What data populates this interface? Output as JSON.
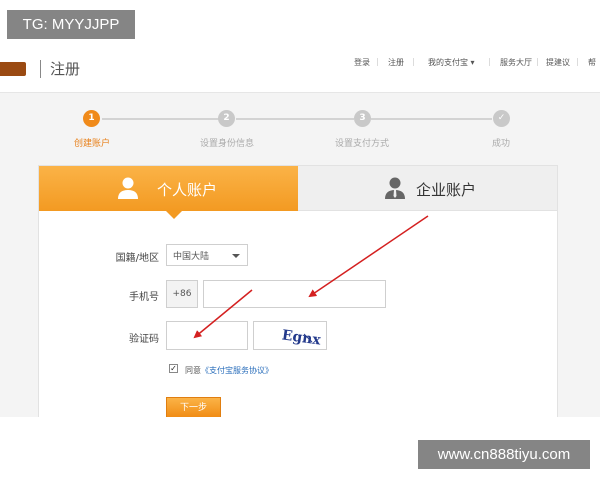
{
  "overlay": {
    "tg_label": "TG: MYYJJPP",
    "watermark": "www.cn888tiyu.com"
  },
  "header": {
    "page_title": "注册",
    "nav": [
      "登录",
      "注册",
      "我的支付宝 ▾",
      "服务大厅",
      "提建议",
      "帮"
    ]
  },
  "stepper": {
    "steps": [
      {
        "number": "1",
        "label": "创建账户",
        "active": true
      },
      {
        "number": "2",
        "label": "设置身份信息",
        "active": false
      },
      {
        "number": "3",
        "label": "设置支付方式",
        "active": false
      },
      {
        "number": "✓",
        "label": "成功",
        "active": false
      }
    ]
  },
  "tabs": {
    "personal": "个人账户",
    "company": "企业账户",
    "personal_icon": "person-icon",
    "company_icon": "business-person-icon"
  },
  "form": {
    "region_label": "国籍/地区",
    "region_value": "中国大陆",
    "phone_label": "手机号",
    "phone_prefix": "+86",
    "phone_value": "",
    "code_label": "验证码",
    "code_value": "",
    "captcha_text": "Egnx",
    "agree_checked": true,
    "agree_prefix": "同意",
    "agree_link": "《支付宝服务协议》",
    "next_label": "下一步"
  },
  "colors": {
    "accent": "#f39a22",
    "arrow": "#d42020",
    "link": "#2a6ebb"
  }
}
